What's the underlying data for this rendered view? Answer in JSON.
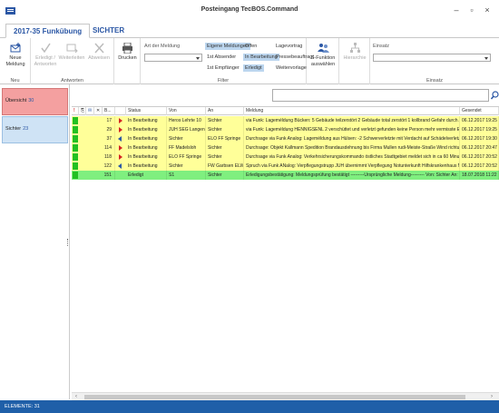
{
  "window": {
    "title": "Posteingang TecBOS.Command"
  },
  "tabs": [
    {
      "label": "2017-35 Funkübung"
    },
    {
      "label": "SICHTER"
    }
  ],
  "ribbon": {
    "neu": {
      "label": "Neue Meldung",
      "group": "Neu"
    },
    "antworten": {
      "erledigt": "Erledigt / Antworten",
      "weiterleiten": "Weiterleiten",
      "abweisen": "Abweisen",
      "group": "Antworten"
    },
    "drucken": {
      "label": "Drucken"
    },
    "filter": {
      "art_label": "Art der Meldung",
      "chips": [
        "Eigene Meldungen",
        "Offen",
        "Lagevortrag",
        "1st Absender",
        "In Bearbeitung",
        "Pressebeauftragt",
        "1st Empfänger",
        "Erledigt",
        "Weitervorlage"
      ],
      "group": "Filter"
    },
    "sfunktion": {
      "label": "S-Funktion auswählen"
    },
    "hierarchie": {
      "label": "Hierarchie"
    },
    "einsatz": {
      "label": "Einsatz",
      "group": "Einsatz"
    }
  },
  "leftpane": {
    "items": [
      {
        "label": "Übersicht",
        "count": "30"
      },
      {
        "label": "Sichter",
        "count": "23"
      }
    ]
  },
  "table": {
    "columns": [
      "",
      "",
      "",
      "B...",
      "",
      "Status",
      "Von",
      "An",
      "Meldung",
      "Gesendet"
    ],
    "rows": [
      {
        "num": "17",
        "flag": "red",
        "status": "In Bearbeitung",
        "von": "Heros Lehrte 10",
        "an": "Sichter",
        "meldung": "via Funk: Lageméldung Bücken: 5 Gebäude teilzerstört 2 Gebäude total zerstört 1 kollbrand Gefahr durch Austr...",
        "gesendet": "06.12.2017 19:25",
        "color": "#ffff99"
      },
      {
        "num": "29",
        "flag": "red",
        "status": "In Bearbeitung",
        "von": "JUH SEG Langen...",
        "an": "Sichter",
        "meldung": "via Funk: Lageméldung HENNIGSENL 2 verschüttet und verletzt gefunden keine Person mehr vermisste Einsat...",
        "gesendet": "06.12.2017 19:25",
        "color": "#ffff99"
      },
      {
        "num": "37",
        "flag": "blue",
        "status": "In Bearbeitung",
        "von": "Sichter",
        "an": "ELO FF Springe",
        "meldung": "Durchsage via Funk Analog: Lageméldung aus Hülsen: -2 Schwerverletzte mit Verdacht auf Schädelverletzunge...",
        "gesendet": "06.12.2017 19:30",
        "color": "#ffff99"
      },
      {
        "num": "114",
        "flag": "red",
        "status": "In Bearbeitung",
        "von": "FF Madelsloh",
        "an": "Sichter",
        "meldung": "Durchsage: Objekt Kallmann Spedition Brandausdehnung bis Firma Mullen rudi-Meiste-Straße Wind richtund Nor...",
        "gesendet": "06.12.2017 20:47",
        "color": "#ffff99"
      },
      {
        "num": "118",
        "flag": "red",
        "status": "In Bearbeitung",
        "von": "ELO FF Springe",
        "an": "Sichter",
        "meldung": "Durchsage via Funk Analog: Verkehrsicherungskommando östliches Stadtgebiet meldet sich in ca 60 Minuten Meld...",
        "gesendet": "06.12.2017 20:52",
        "color": "#ffff99"
      },
      {
        "num": "122",
        "flag": "blue",
        "status": "In Bearbeitung",
        "von": "Sichter",
        "an": "FW Garbsen ELW 2",
        "meldung": "Spruch via Funk ANalog: Verpflegungstrupp JUH übernimmt Verpflegung Notunterkunft Hilfskrankenhaus MVB or...",
        "gesendet": "06.12.2017 20:52",
        "color": "#ffff99"
      },
      {
        "num": "151",
        "flag": "",
        "status": "Erledigt",
        "von": "S1",
        "an": "Sichter",
        "meldung": "Erledigungsbestätigung: Meldungsprüfung bestätigt ---------Ursprüngliche Meldung--------- Von: Sichter An: S...",
        "gesendet": "18.07.2018 11:22",
        "color": "#7fef7f"
      }
    ]
  },
  "status": {
    "text": "ELEMENTE: 31"
  }
}
